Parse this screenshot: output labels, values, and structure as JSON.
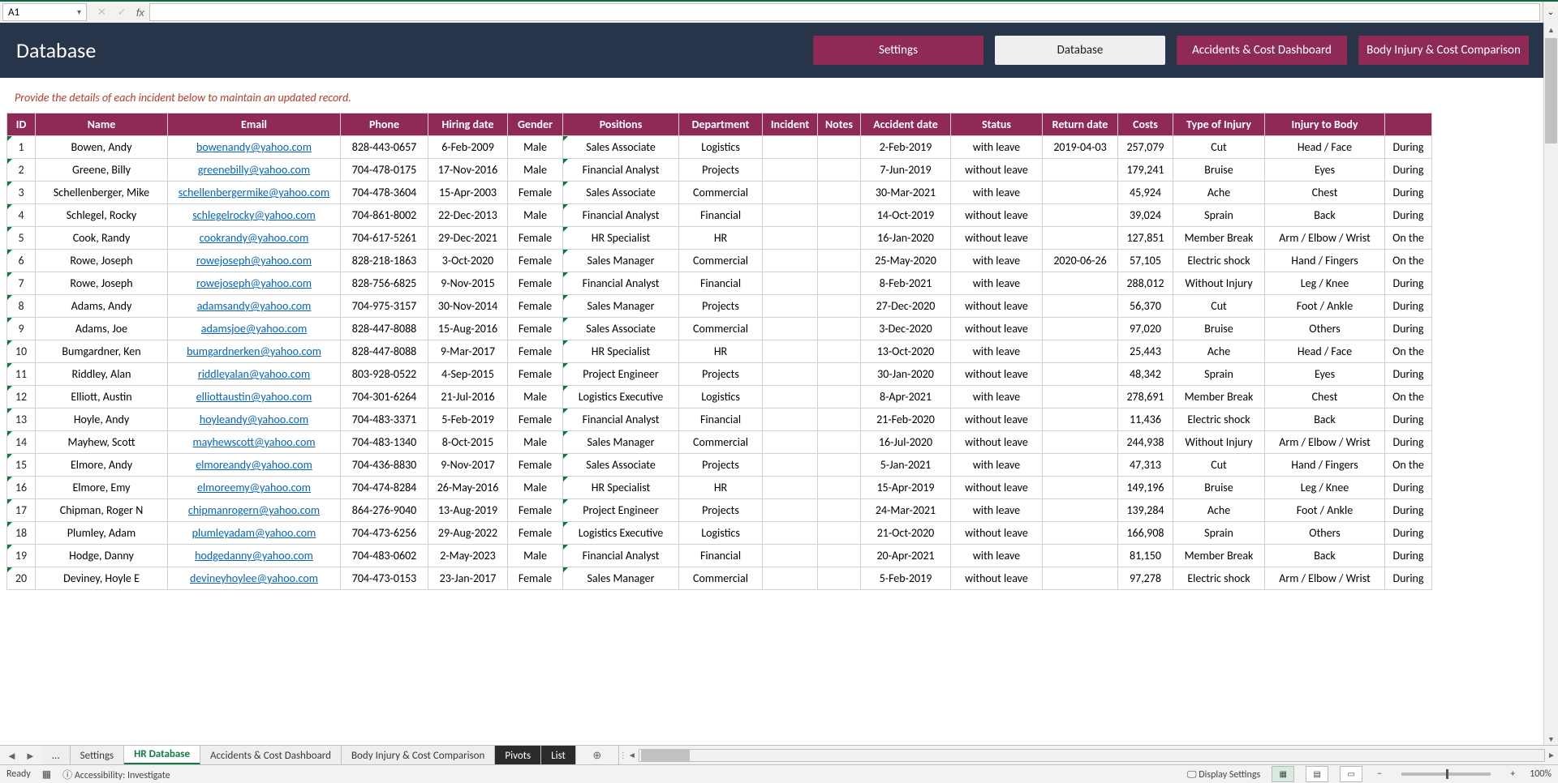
{
  "formula_bar": {
    "cell_ref": "A1",
    "fx_label": "fx",
    "value": ""
  },
  "banner": {
    "title": "Database",
    "nav": [
      {
        "label": "Settings",
        "active": false
      },
      {
        "label": "Database",
        "active": true
      },
      {
        "label": "Accidents & Cost Dashboard",
        "active": false
      },
      {
        "label": "Body Injury & Cost Comparison",
        "active": false
      }
    ]
  },
  "instruction": "Provide the details of each incident below to maintain an updated record.",
  "columns": [
    "ID",
    "Name",
    "Email",
    "Phone",
    "Hiring date",
    "Gender",
    "Positions",
    "Department",
    "Incident",
    "Notes",
    "Accident date",
    "Status",
    "Return date",
    "Costs",
    "Type of Injury",
    "Injury to Body",
    ""
  ],
  "rows": [
    {
      "id": "1",
      "name": "Bowen, Andy",
      "email": "bowenandy@yahoo.com",
      "phone": "828-443-0657",
      "hire": "6-Feb-2009",
      "gender": "Male",
      "pos": "Sales Associate",
      "dept": "Logistics",
      "inc": "",
      "notes": "",
      "acc": "2-Feb-2019",
      "stat": "with leave",
      "ret": "2019-04-03",
      "cost": "257,079",
      "inj": "Cut",
      "body": "Head / Face",
      "last": "During"
    },
    {
      "id": "2",
      "name": "Greene, Billy",
      "email": "greenebilly@yahoo.com",
      "phone": "704-478-0175",
      "hire": "17-Nov-2016",
      "gender": "Male",
      "pos": "Financial Analyst",
      "dept": "Projects",
      "inc": "",
      "notes": "",
      "acc": "7-Jun-2019",
      "stat": "without leave",
      "ret": "",
      "cost": "179,241",
      "inj": "Bruise",
      "body": "Eyes",
      "last": "During"
    },
    {
      "id": "3",
      "name": "Schellenberger, Mike",
      "email": "schellenbergermike@yahoo.com",
      "phone": "704-478-3604",
      "hire": "15-Apr-2003",
      "gender": "Female",
      "pos": "Sales Associate",
      "dept": "Commercial",
      "inc": "",
      "notes": "",
      "acc": "30-Mar-2021",
      "stat": "with leave",
      "ret": "",
      "cost": "45,924",
      "inj": "Ache",
      "body": "Chest",
      "last": "During"
    },
    {
      "id": "4",
      "name": "Schlegel, Rocky",
      "email": "schlegelrocky@yahoo.com",
      "phone": "704-861-8002",
      "hire": "22-Dec-2013",
      "gender": "Male",
      "pos": "Financial Analyst",
      "dept": "Financial",
      "inc": "",
      "notes": "",
      "acc": "14-Oct-2019",
      "stat": "without leave",
      "ret": "",
      "cost": "39,024",
      "inj": "Sprain",
      "body": "Back",
      "last": "During"
    },
    {
      "id": "5",
      "name": "Cook, Randy",
      "email": "cookrandy@yahoo.com",
      "phone": "704-617-5261",
      "hire": "29-Dec-2021",
      "gender": "Female",
      "pos": "HR Specialist",
      "dept": "HR",
      "inc": "",
      "notes": "",
      "acc": "16-Jan-2020",
      "stat": "without leave",
      "ret": "",
      "cost": "127,851",
      "inj": "Member Break",
      "body": "Arm / Elbow / Wrist",
      "last": "On the"
    },
    {
      "id": "6",
      "name": "Rowe, Joseph",
      "email": "rowejoseph@yahoo.com",
      "phone": "828-218-1863",
      "hire": "3-Oct-2020",
      "gender": "Female",
      "pos": "Sales Manager",
      "dept": "Commercial",
      "inc": "",
      "notes": "",
      "acc": "25-May-2020",
      "stat": "with leave",
      "ret": "2020-06-26",
      "cost": "57,105",
      "inj": "Electric shock",
      "body": "Hand / Fingers",
      "last": "On the"
    },
    {
      "id": "7",
      "name": "Rowe, Joseph",
      "email": "rowejoseph@yahoo.com",
      "phone": "828-756-6825",
      "hire": "9-Nov-2015",
      "gender": "Female",
      "pos": "Financial Analyst",
      "dept": "Financial",
      "inc": "",
      "notes": "",
      "acc": "8-Feb-2021",
      "stat": "with leave",
      "ret": "",
      "cost": "288,012",
      "inj": "Without Injury",
      "body": "Leg / Knee",
      "last": "During"
    },
    {
      "id": "8",
      "name": "Adams, Andy",
      "email": "adamsandy@yahoo.com",
      "phone": "704-975-3157",
      "hire": "30-Nov-2014",
      "gender": "Female",
      "pos": "Sales Manager",
      "dept": "Projects",
      "inc": "",
      "notes": "",
      "acc": "27-Dec-2020",
      "stat": "without leave",
      "ret": "",
      "cost": "56,370",
      "inj": "Cut",
      "body": "Foot / Ankle",
      "last": "During"
    },
    {
      "id": "9",
      "name": "Adams, Joe",
      "email": "adamsjoe@yahoo.com",
      "phone": "828-447-8088",
      "hire": "15-Aug-2016",
      "gender": "Female",
      "pos": "Sales Associate",
      "dept": "Commercial",
      "inc": "",
      "notes": "",
      "acc": "3-Dec-2020",
      "stat": "without leave",
      "ret": "",
      "cost": "97,020",
      "inj": "Bruise",
      "body": "Others",
      "last": "During"
    },
    {
      "id": "10",
      "name": "Bumgardner, Ken",
      "email": "bumgardnerken@yahoo.com",
      "phone": "828-447-8088",
      "hire": "9-Mar-2017",
      "gender": "Female",
      "pos": "HR Specialist",
      "dept": "HR",
      "inc": "",
      "notes": "",
      "acc": "13-Oct-2020",
      "stat": "with leave",
      "ret": "",
      "cost": "25,443",
      "inj": "Ache",
      "body": "Head / Face",
      "last": "On the"
    },
    {
      "id": "11",
      "name": "Riddley, Alan",
      "email": "riddleyalan@yahoo.com",
      "phone": "803-928-0522",
      "hire": "4-Sep-2015",
      "gender": "Female",
      "pos": "Project Engineer",
      "dept": "Projects",
      "inc": "",
      "notes": "",
      "acc": "30-Jan-2020",
      "stat": "without leave",
      "ret": "",
      "cost": "48,342",
      "inj": "Sprain",
      "body": "Eyes",
      "last": "During"
    },
    {
      "id": "12",
      "name": "Elliott, Austin",
      "email": "elliottaustin@yahoo.com",
      "phone": "704-301-6264",
      "hire": "21-Jul-2016",
      "gender": "Male",
      "pos": "Logistics Executive",
      "dept": "Logistics",
      "inc": "",
      "notes": "",
      "acc": "8-Apr-2021",
      "stat": "with leave",
      "ret": "",
      "cost": "278,691",
      "inj": "Member Break",
      "body": "Chest",
      "last": "On the"
    },
    {
      "id": "13",
      "name": "Hoyle, Andy",
      "email": "hoyleandy@yahoo.com",
      "phone": "704-483-3371",
      "hire": "5-Feb-2019",
      "gender": "Female",
      "pos": "Financial Analyst",
      "dept": "Financial",
      "inc": "",
      "notes": "",
      "acc": "21-Feb-2020",
      "stat": "without leave",
      "ret": "",
      "cost": "11,436",
      "inj": "Electric shock",
      "body": "Back",
      "last": "During"
    },
    {
      "id": "14",
      "name": "Mayhew, Scott",
      "email": "mayhewscott@yahoo.com",
      "phone": "704-483-1340",
      "hire": "8-Oct-2015",
      "gender": "Male",
      "pos": "Sales Manager",
      "dept": "Commercial",
      "inc": "",
      "notes": "",
      "acc": "16-Jul-2020",
      "stat": "without leave",
      "ret": "",
      "cost": "244,938",
      "inj": "Without Injury",
      "body": "Arm / Elbow / Wrist",
      "last": "During"
    },
    {
      "id": "15",
      "name": "Elmore, Andy",
      "email": "elmoreandy@yahoo.com",
      "phone": "704-436-8830",
      "hire": "9-Nov-2017",
      "gender": "Female",
      "pos": "Sales Associate",
      "dept": "Projects",
      "inc": "",
      "notes": "",
      "acc": "5-Jan-2021",
      "stat": "with leave",
      "ret": "",
      "cost": "47,313",
      "inj": "Cut",
      "body": "Hand / Fingers",
      "last": "On the"
    },
    {
      "id": "16",
      "name": "Elmore, Emy",
      "email": "elmoreemy@yahoo.com",
      "phone": "704-474-8284",
      "hire": "26-May-2016",
      "gender": "Male",
      "pos": "HR Specialist",
      "dept": "HR",
      "inc": "",
      "notes": "",
      "acc": "15-Apr-2019",
      "stat": "without leave",
      "ret": "",
      "cost": "149,196",
      "inj": "Bruise",
      "body": "Leg / Knee",
      "last": "During"
    },
    {
      "id": "17",
      "name": "Chipman, Roger N",
      "email": "chipmanrogern@yahoo.com",
      "phone": "864-276-9040",
      "hire": "13-Aug-2019",
      "gender": "Female",
      "pos": "Project Engineer",
      "dept": "Projects",
      "inc": "",
      "notes": "",
      "acc": "24-Mar-2021",
      "stat": "with leave",
      "ret": "",
      "cost": "139,284",
      "inj": "Ache",
      "body": "Foot / Ankle",
      "last": "During"
    },
    {
      "id": "18",
      "name": "Plumley, Adam",
      "email": "plumleyadam@yahoo.com",
      "phone": "704-473-6256",
      "hire": "29-Aug-2022",
      "gender": "Female",
      "pos": "Logistics Executive",
      "dept": "Logistics",
      "inc": "",
      "notes": "",
      "acc": "21-Oct-2020",
      "stat": "without leave",
      "ret": "",
      "cost": "166,908",
      "inj": "Sprain",
      "body": "Others",
      "last": "During"
    },
    {
      "id": "19",
      "name": "Hodge, Danny",
      "email": "hodgedanny@yahoo.com",
      "phone": "704-483-0602",
      "hire": "2-May-2023",
      "gender": "Male",
      "pos": "Financial Analyst",
      "dept": "Financial",
      "inc": "",
      "notes": "",
      "acc": "20-Apr-2021",
      "stat": "with leave",
      "ret": "",
      "cost": "81,150",
      "inj": "Member Break",
      "body": "Back",
      "last": "During"
    },
    {
      "id": "20",
      "name": "Deviney, Hoyle E",
      "email": "devineyhoylee@yahoo.com",
      "phone": "704-473-0153",
      "hire": "23-Jan-2017",
      "gender": "Female",
      "pos": "Sales Manager",
      "dept": "Commercial",
      "inc": "",
      "notes": "",
      "acc": "5-Feb-2019",
      "stat": "without leave",
      "ret": "",
      "cost": "97,278",
      "inj": "Electric shock",
      "body": "Arm / Elbow / Wrist",
      "last": "During"
    }
  ],
  "sheet_tabs": [
    {
      "label": "...",
      "style": "nav"
    },
    {
      "label": "Settings",
      "style": "normal"
    },
    {
      "label": "HR Database",
      "style": "active"
    },
    {
      "label": "Accidents & Cost Dashboard",
      "style": "normal"
    },
    {
      "label": "Body Injury & Cost Comparison",
      "style": "normal"
    },
    {
      "label": "Pivots",
      "style": "dark"
    },
    {
      "label": "List",
      "style": "dark"
    }
  ],
  "status_bar": {
    "mode": "Ready",
    "accessibility": "Accessibility: Investigate",
    "display_settings": "Display Settings",
    "zoom": "100%"
  }
}
